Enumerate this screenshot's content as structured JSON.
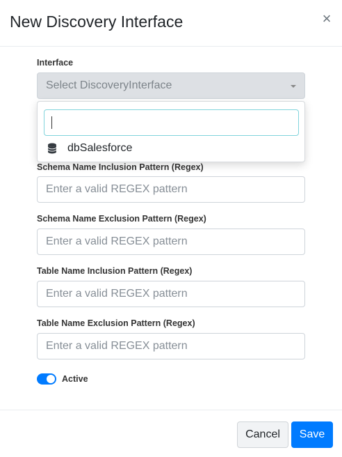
{
  "modal": {
    "title": "New Discovery Interface",
    "close_glyph": "×"
  },
  "interface": {
    "label": "Interface",
    "placeholder": "Select DiscoveryInterface",
    "dropdown": {
      "search_value": "",
      "items": [
        {
          "label": "dbSalesforce",
          "icon": "database-icon"
        }
      ]
    }
  },
  "fields": [
    {
      "label": "Schema Name Inclusion Pattern (Regex)",
      "placeholder": "Enter a valid REGEX pattern",
      "value": ""
    },
    {
      "label": "Schema Name Exclusion Pattern (Regex)",
      "placeholder": "Enter a valid REGEX pattern",
      "value": ""
    },
    {
      "label": "Table Name Inclusion Pattern (Regex)",
      "placeholder": "Enter a valid REGEX pattern",
      "value": ""
    },
    {
      "label": "Table Name Exclusion Pattern (Regex)",
      "placeholder": "Enter a valid REGEX pattern",
      "value": ""
    }
  ],
  "active": {
    "label": "Active",
    "checked": true
  },
  "footer": {
    "cancel_label": "Cancel",
    "save_label": "Save"
  },
  "colors": {
    "primary": "#007bff",
    "focus_border": "#80d4dc",
    "disabled_select_bg": "#dde0e4"
  }
}
